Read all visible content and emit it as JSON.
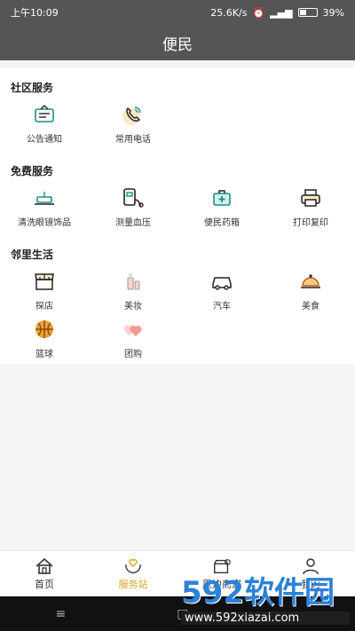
{
  "status_bar": {
    "time": "上午10:09",
    "net_speed": "25.6K/s",
    "battery_percent": "39%"
  },
  "header": {
    "title": "便民"
  },
  "sections": [
    {
      "title": "社区服务",
      "items": [
        {
          "label": "公告通知",
          "icon": "notice-board-icon"
        },
        {
          "label": "常用电话",
          "icon": "phone-icon"
        }
      ]
    },
    {
      "title": "免费服务",
      "items": [
        {
          "label": "清洗眼镜饰品",
          "icon": "cleaning-icon"
        },
        {
          "label": "测量血压",
          "icon": "blood-pressure-icon"
        },
        {
          "label": "便民药箱",
          "icon": "medicine-box-icon"
        },
        {
          "label": "打印复印",
          "icon": "printer-icon"
        }
      ]
    },
    {
      "title": "邻里生活",
      "items": [
        {
          "label": "探店",
          "icon": "shop-icon"
        },
        {
          "label": "美妆",
          "icon": "cosmetics-icon"
        },
        {
          "label": "汽车",
          "icon": "car-icon"
        },
        {
          "label": "美食",
          "icon": "food-cloche-icon"
        },
        {
          "label": "篮球",
          "icon": "basketball-icon"
        },
        {
          "label": "团购",
          "icon": "group-buy-icon"
        }
      ]
    }
  ],
  "tabbar": {
    "items": [
      {
        "label": "首页",
        "icon": "home-icon",
        "active": false
      },
      {
        "label": "服务站",
        "icon": "heart-hands-icon",
        "active": true
      },
      {
        "label": "周边商家",
        "icon": "store-icon",
        "active": false
      },
      {
        "label": "我的",
        "icon": "user-icon",
        "active": false
      }
    ]
  },
  "system_nav": {
    "menu": "≡",
    "home": "□"
  },
  "watermark": {
    "logo": "592软件园",
    "url": "www.592xiazai.com"
  },
  "colors": {
    "header_bg": "#555555",
    "accent": "#d9a520",
    "icon_teal": "#1a8f86",
    "icon_orange": "#e8a23a"
  }
}
